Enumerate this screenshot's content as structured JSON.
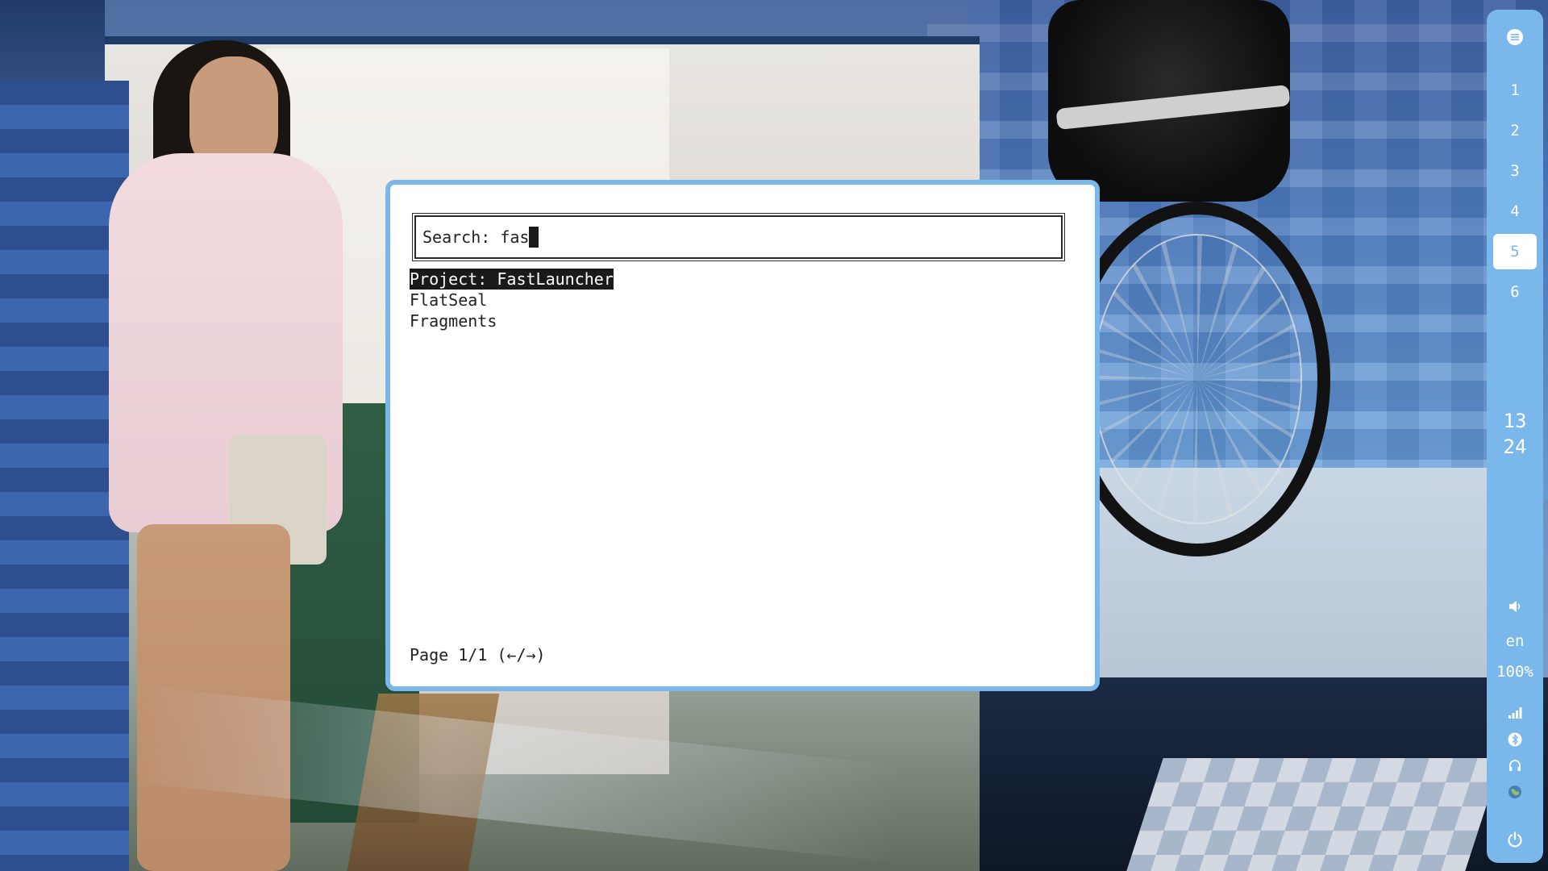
{
  "launcher": {
    "search_prefix": "Search: ",
    "search_query": "fas",
    "results": [
      {
        "label": "Project: FastLauncher",
        "selected": true
      },
      {
        "label": "FlatSeal",
        "selected": false
      },
      {
        "label": "Fragments",
        "selected": false
      }
    ],
    "page_indicator": "Page 1/1 (←/→)"
  },
  "bar": {
    "menu_icon": "menu-icon",
    "workspaces": [
      {
        "label": "1",
        "active": false
      },
      {
        "label": "2",
        "active": false
      },
      {
        "label": "3",
        "active": false
      },
      {
        "label": "4",
        "active": false
      },
      {
        "label": "5",
        "active": true
      },
      {
        "label": "6",
        "active": false
      }
    ],
    "clock": {
      "hour": "13",
      "minute": "24"
    },
    "volume_icon": "volume-icon",
    "language": "en",
    "brightness": "100%",
    "status_icons": [
      "signal-icon",
      "bluetooth-icon",
      "headphone-icon",
      "globe-icon"
    ],
    "power_icon": "power-icon"
  },
  "colors": {
    "accent": "#7ab8ec",
    "selection_bg": "#1a1a1a",
    "text": "#222222"
  }
}
